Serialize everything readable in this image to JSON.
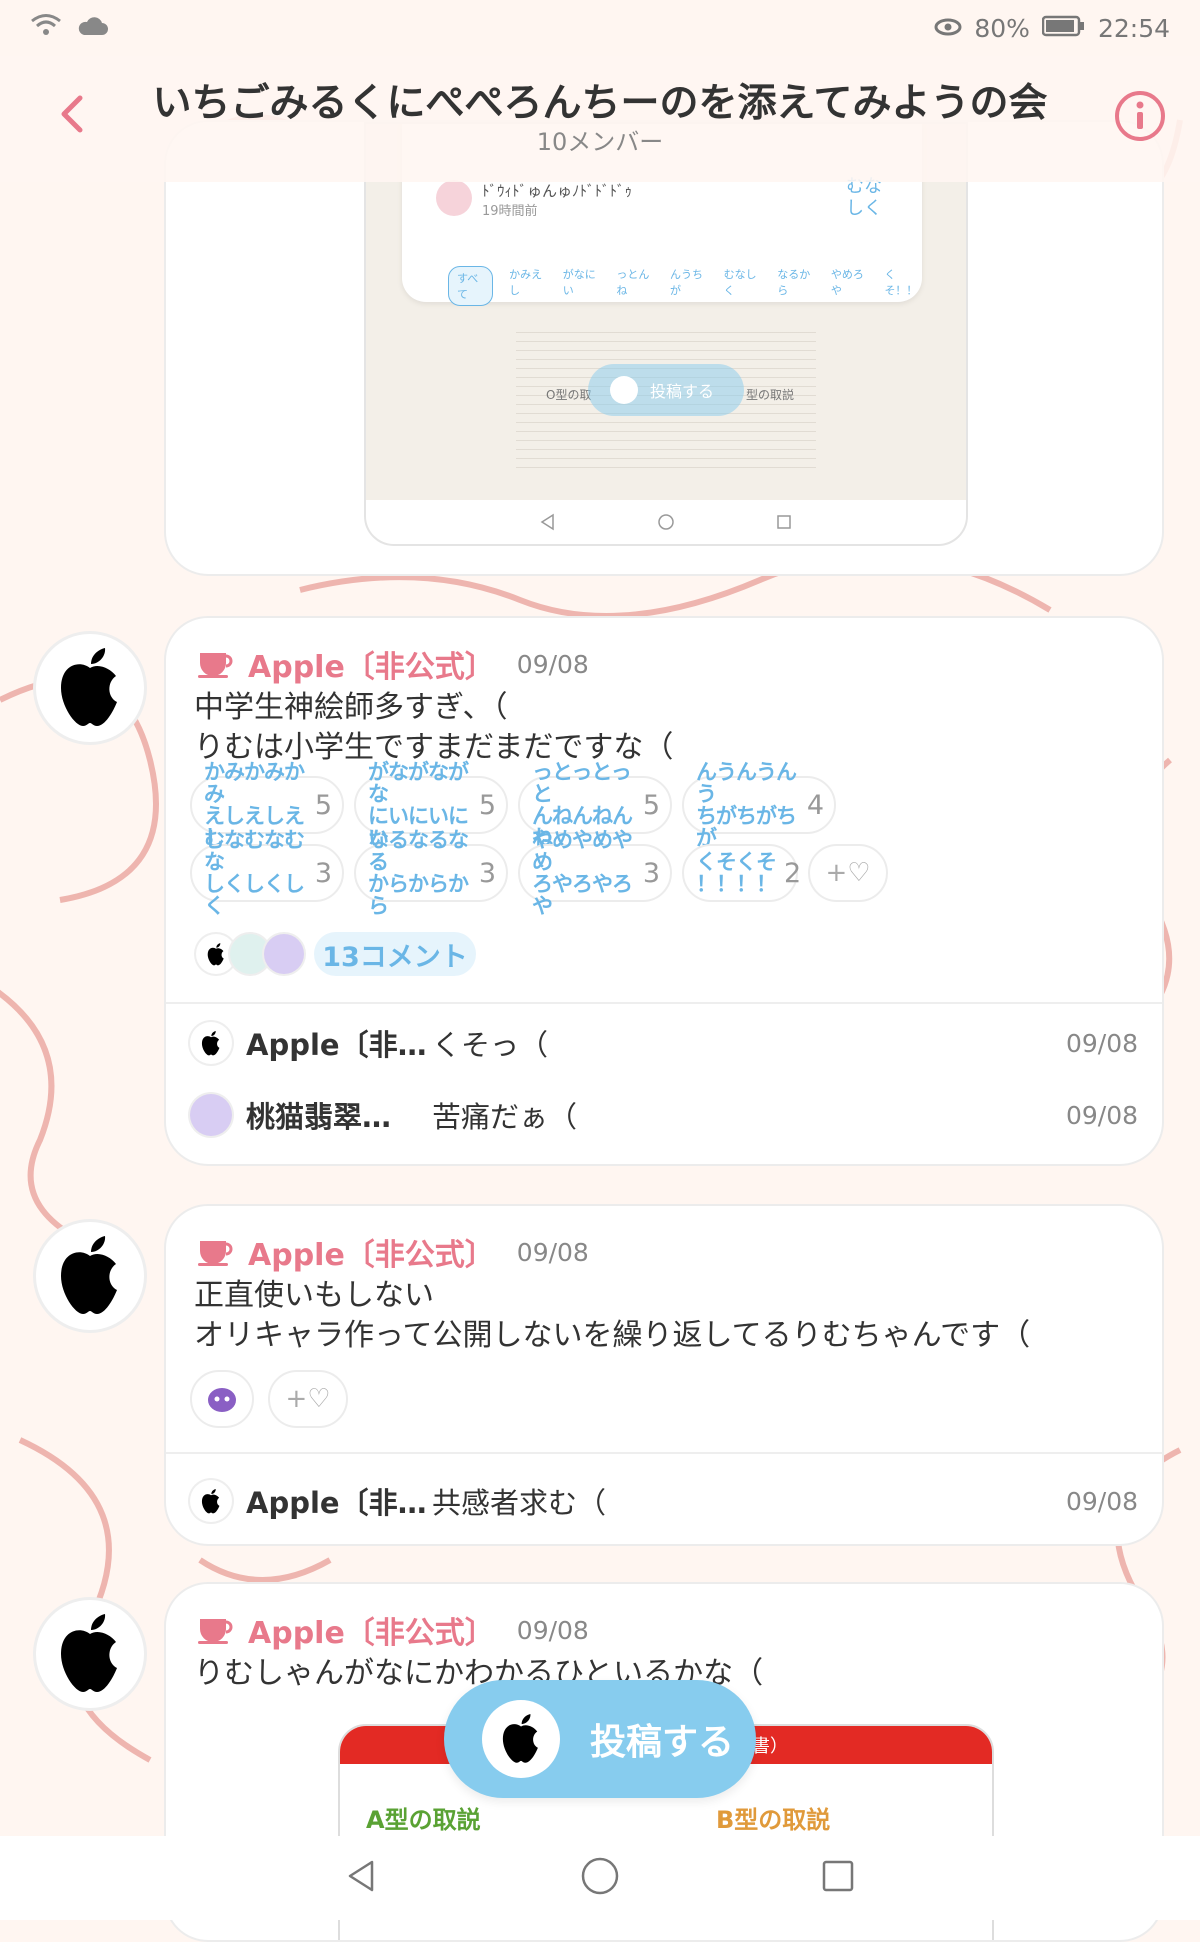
{
  "statusbar": {
    "battery": "80%",
    "time": "22:54"
  },
  "header": {
    "title": "いちごみるくにぺぺろんちーのを添えてみようの会",
    "members": "10メンバー"
  },
  "top_screenshot": {
    "username": "ﾄﾞｳｨﾄﾞゅんゅﾉﾄﾞﾄﾞﾄﾞｩ",
    "time": "19時間前",
    "chip_labels": [
      "すべて",
      "かみえし",
      "がなにい",
      "っとんね",
      "んうちが",
      "むなしく",
      "なるから",
      "やめろや",
      "くそ！！"
    ],
    "post_button": "投稿する",
    "corner_label_1": "むな",
    "corner_label_2": "しく",
    "doc_label_left": "O型の取",
    "doc_label_right": "型の取説"
  },
  "posts": [
    {
      "author": "Apple〔非公式〕",
      "date": "09/08",
      "text": "中学生神絵師多すぎ、（\nりむは小学生ですまだまだですな（",
      "reactions": [
        {
          "l1": "かみかみかみ",
          "l2": "えしえしえし",
          "count": "5"
        },
        {
          "l1": "がながながな",
          "l2": "にいにいにい",
          "count": "5"
        },
        {
          "l1": "っとっとっと",
          "l2": "んねんねんね",
          "count": "5"
        },
        {
          "l1": "んうんうんう",
          "l2": "ちがちがちが",
          "count": "4"
        },
        {
          "l1": "むなむなむな",
          "l2": "しくしくしく",
          "count": "3"
        },
        {
          "l1": "なるなるなる",
          "l2": "からからから",
          "count": "3"
        },
        {
          "l1": "やめやめやめ",
          "l2": "ろやろやろや",
          "count": "3"
        },
        {
          "l1": "くそくそ",
          "l2": "！！！！",
          "count": "2"
        }
      ],
      "add_reaction": "+♡",
      "comment_count": "13コメント",
      "comments": [
        {
          "name": "Apple〔非…",
          "text": "くそっ（",
          "date": "09/08"
        },
        {
          "name": "桃猫翡翠…",
          "text": "苦痛だぁ（",
          "date": "09/08"
        }
      ]
    },
    {
      "author": "Apple〔非公式〕",
      "date": "09/08",
      "text": "正直使いもしない\nオリキャラ作って公開しないを繰り返してるりむちゃんです（",
      "add_reaction": "+♡",
      "comments": [
        {
          "name": "Apple〔非…",
          "text": "共感者求む（",
          "date": "09/08"
        }
      ]
    },
    {
      "author": "Apple〔非公式〕",
      "date": "09/08",
      "text": "りむしゃんがなにかわかるひといるかな（",
      "attachment": {
        "label_a": "A型の取説",
        "label_b": "B型の取説",
        "header_tail": "書）"
      }
    }
  ],
  "fab": {
    "label": "投稿する"
  },
  "colors": {
    "accent": "#e8798b",
    "sky": "#87ccee",
    "chip_text": "#6ab6e6"
  }
}
